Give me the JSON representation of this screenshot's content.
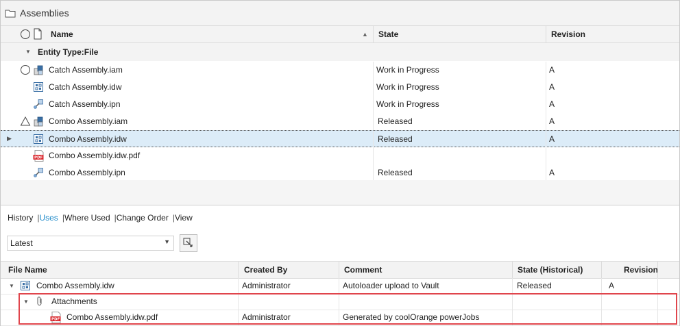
{
  "window": {
    "title": "Assemblies"
  },
  "top_table": {
    "columns": {
      "name": "Name",
      "state": "State",
      "revision": "Revision"
    },
    "group_label": "Entity Type:File",
    "rows": [
      {
        "status": "circle",
        "icon": "assembly-icon",
        "name": "Catch Assembly.iam",
        "state": "Work in Progress",
        "revision": "A",
        "selected": false
      },
      {
        "status": "",
        "icon": "drawing-icon",
        "name": "Catch Assembly.idw",
        "state": "Work in Progress",
        "revision": "A",
        "selected": false
      },
      {
        "status": "",
        "icon": "presentation-icon",
        "name": "Catch Assembly.ipn",
        "state": "Work in Progress",
        "revision": "A",
        "selected": false
      },
      {
        "status": "triangle",
        "icon": "assembly-icon",
        "name": "Combo Assembly.iam",
        "state": "Released",
        "revision": "A",
        "selected": false
      },
      {
        "status": "",
        "icon": "drawing-icon",
        "name": "Combo Assembly.idw",
        "state": "Released",
        "revision": "A",
        "selected": true
      },
      {
        "status": "",
        "icon": "pdf-icon",
        "name": "Combo Assembly.idw.pdf",
        "state": "",
        "revision": "",
        "selected": false
      },
      {
        "status": "",
        "icon": "presentation-icon",
        "name": "Combo Assembly.ipn",
        "state": "Released",
        "revision": "A",
        "selected": false
      }
    ]
  },
  "tabs": [
    {
      "label": "History",
      "active": false
    },
    {
      "label": "Uses",
      "active": true
    },
    {
      "label": "Where Used",
      "active": false
    },
    {
      "label": "Change Order",
      "active": false
    },
    {
      "label": "View",
      "active": false
    }
  ],
  "version_dropdown": {
    "value": "Latest"
  },
  "bottom_table": {
    "columns": {
      "file_name": "File Name",
      "created_by": "Created By",
      "comment": "Comment",
      "state": "State (Historical)",
      "revision": "Revision"
    },
    "rows": [
      {
        "file_name": "Combo Assembly.idw",
        "created_by": "Administrator",
        "comment": "Autoloader upload to Vault",
        "state": "Released",
        "revision": "A"
      },
      {
        "file_name": "Attachments",
        "created_by": "",
        "comment": "",
        "state": "",
        "revision": ""
      },
      {
        "file_name": "Combo Assembly.idw.pdf",
        "created_by": "Administrator",
        "comment": "Generated by coolOrange powerJobs",
        "state": "",
        "revision": ""
      }
    ]
  },
  "colors": {
    "accent": "#1f8ac9",
    "selection": "#dcecf8",
    "highlight_box": "#e0454c",
    "pdf_red": "#d9262c"
  }
}
